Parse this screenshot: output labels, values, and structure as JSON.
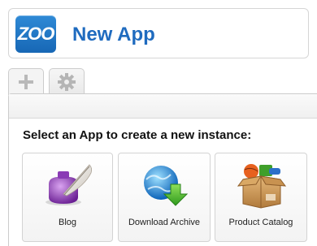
{
  "header": {
    "logo_text": "ZOO",
    "title": "New App"
  },
  "tabs": [
    {
      "icon": "plus-icon",
      "active": true
    },
    {
      "icon": "gear-icon",
      "active": false
    }
  ],
  "main": {
    "instruction": "Select an App to create a new instance:",
    "apps": [
      {
        "label": "Blog",
        "icon": "ink-quill-icon"
      },
      {
        "label": "Download Archive",
        "icon": "globe-download-icon"
      },
      {
        "label": "Product Catalog",
        "icon": "product-box-icon"
      }
    ]
  },
  "colors": {
    "title": "#1f6bbf",
    "logo": "#1767b5"
  }
}
